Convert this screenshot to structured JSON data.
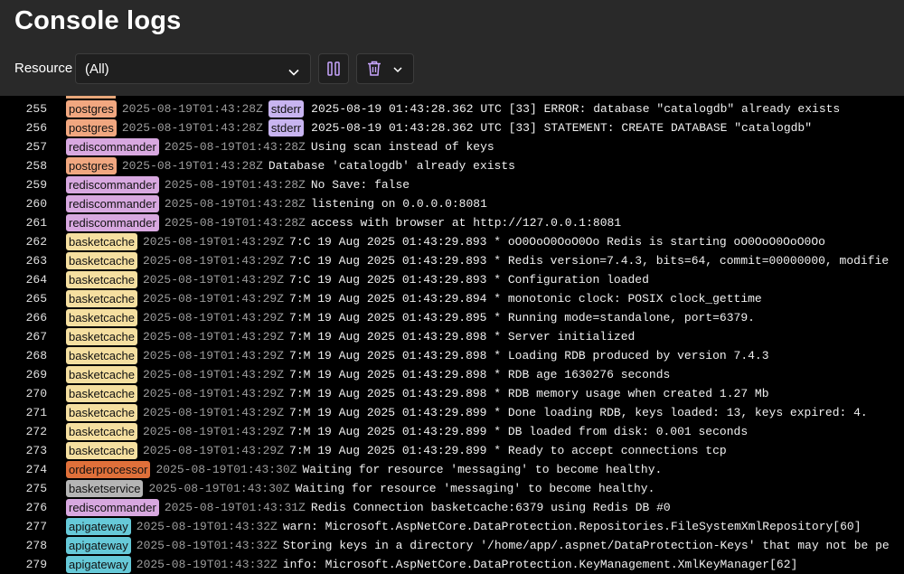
{
  "header": {
    "title": "Console logs",
    "resource_label": "Resource",
    "resource_value": "(All)"
  },
  "colors": {
    "postgres": "#f1a780",
    "rediscommander": "#d8a8e0",
    "basketcache": "#f5dfa0",
    "orderprocessor": "#e0703a",
    "basketservice": "#b5b5b5",
    "apigateway": "#66c9d8"
  },
  "rows": [
    {
      "n": "255",
      "res": "postgres",
      "ts": "2025-08-19T01:43:28Z",
      "stream": "stderr",
      "msg": "2025-08-19 01:43:28.362 UTC [33] ERROR: database \"catalogdb\" already exists"
    },
    {
      "n": "256",
      "res": "postgres",
      "ts": "2025-08-19T01:43:28Z",
      "stream": "stderr",
      "msg": "2025-08-19 01:43:28.362 UTC [33] STATEMENT: CREATE DATABASE \"catalogdb\""
    },
    {
      "n": "257",
      "res": "rediscommander",
      "ts": "2025-08-19T01:43:28Z",
      "stream": "",
      "msg": "Using scan instead of keys"
    },
    {
      "n": "258",
      "res": "postgres",
      "ts": "2025-08-19T01:43:28Z",
      "stream": "",
      "msg": "Database 'catalogdb' already exists"
    },
    {
      "n": "259",
      "res": "rediscommander",
      "ts": "2025-08-19T01:43:28Z",
      "stream": "",
      "msg": "No Save: false"
    },
    {
      "n": "260",
      "res": "rediscommander",
      "ts": "2025-08-19T01:43:28Z",
      "stream": "",
      "msg": "listening on 0.0.0.0:8081"
    },
    {
      "n": "261",
      "res": "rediscommander",
      "ts": "2025-08-19T01:43:28Z",
      "stream": "",
      "msg": "access with browser at http://127.0.0.1:8081"
    },
    {
      "n": "262",
      "res": "basketcache",
      "ts": "2025-08-19T01:43:29Z",
      "stream": "",
      "msg": "7:C 19 Aug 2025 01:43:29.893 * oO0OoO0OoO0Oo Redis is starting oO0OoO0OoO0Oo"
    },
    {
      "n": "263",
      "res": "basketcache",
      "ts": "2025-08-19T01:43:29Z",
      "stream": "",
      "msg": "7:C 19 Aug 2025 01:43:29.893 * Redis version=7.4.3, bits=64, commit=00000000, modifie"
    },
    {
      "n": "264",
      "res": "basketcache",
      "ts": "2025-08-19T01:43:29Z",
      "stream": "",
      "msg": "7:C 19 Aug 2025 01:43:29.893 * Configuration loaded"
    },
    {
      "n": "265",
      "res": "basketcache",
      "ts": "2025-08-19T01:43:29Z",
      "stream": "",
      "msg": "7:M 19 Aug 2025 01:43:29.894 * monotonic clock: POSIX clock_gettime"
    },
    {
      "n": "266",
      "res": "basketcache",
      "ts": "2025-08-19T01:43:29Z",
      "stream": "",
      "msg": "7:M 19 Aug 2025 01:43:29.895 * Running mode=standalone, port=6379."
    },
    {
      "n": "267",
      "res": "basketcache",
      "ts": "2025-08-19T01:43:29Z",
      "stream": "",
      "msg": "7:M 19 Aug 2025 01:43:29.898 * Server initialized"
    },
    {
      "n": "268",
      "res": "basketcache",
      "ts": "2025-08-19T01:43:29Z",
      "stream": "",
      "msg": "7:M 19 Aug 2025 01:43:29.898 * Loading RDB produced by version 7.4.3"
    },
    {
      "n": "269",
      "res": "basketcache",
      "ts": "2025-08-19T01:43:29Z",
      "stream": "",
      "msg": "7:M 19 Aug 2025 01:43:29.898 * RDB age 1630276 seconds"
    },
    {
      "n": "270",
      "res": "basketcache",
      "ts": "2025-08-19T01:43:29Z",
      "stream": "",
      "msg": "7:M 19 Aug 2025 01:43:29.898 * RDB memory usage when created 1.27 Mb"
    },
    {
      "n": "271",
      "res": "basketcache",
      "ts": "2025-08-19T01:43:29Z",
      "stream": "",
      "msg": "7:M 19 Aug 2025 01:43:29.899 * Done loading RDB, keys loaded: 13, keys expired: 4."
    },
    {
      "n": "272",
      "res": "basketcache",
      "ts": "2025-08-19T01:43:29Z",
      "stream": "",
      "msg": "7:M 19 Aug 2025 01:43:29.899 * DB loaded from disk: 0.001 seconds"
    },
    {
      "n": "273",
      "res": "basketcache",
      "ts": "2025-08-19T01:43:29Z",
      "stream": "",
      "msg": "7:M 19 Aug 2025 01:43:29.899 * Ready to accept connections tcp"
    },
    {
      "n": "274",
      "res": "orderprocessor",
      "ts": "2025-08-19T01:43:30Z",
      "stream": "",
      "msg": "Waiting for resource 'messaging' to become healthy."
    },
    {
      "n": "275",
      "res": "basketservice",
      "ts": "2025-08-19T01:43:30Z",
      "stream": "",
      "msg": "Waiting for resource 'messaging' to become healthy."
    },
    {
      "n": "276",
      "res": "rediscommander",
      "ts": "2025-08-19T01:43:31Z",
      "stream": "",
      "msg": "Redis Connection basketcache:6379 using Redis DB #0"
    },
    {
      "n": "277",
      "res": "apigateway",
      "ts": "2025-08-19T01:43:32Z",
      "stream": "",
      "msg": "warn: Microsoft.AspNetCore.DataProtection.Repositories.FileSystemXmlRepository[60]"
    },
    {
      "n": "278",
      "res": "apigateway",
      "ts": "2025-08-19T01:43:32Z",
      "stream": "",
      "msg": "Storing keys in a directory '/home/app/.aspnet/DataProtection-Keys' that may not be pe"
    },
    {
      "n": "279",
      "res": "apigateway",
      "ts": "2025-08-19T01:43:32Z",
      "stream": "",
      "msg": "info: Microsoft.AspNetCore.DataProtection.KeyManagement.XmlKeyManager[62]"
    }
  ]
}
